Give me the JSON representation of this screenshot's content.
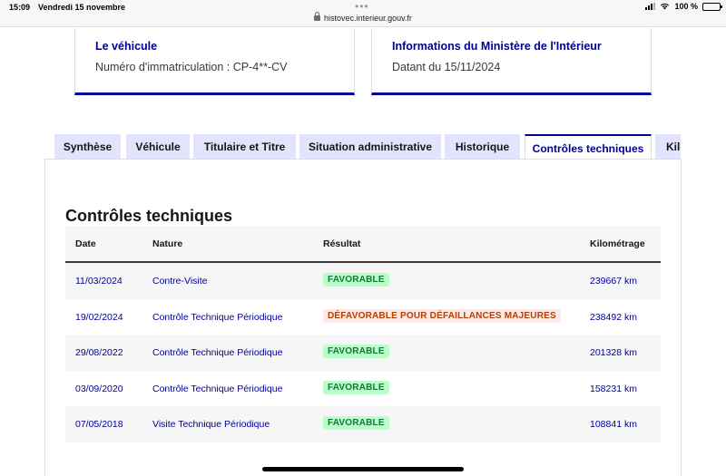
{
  "status_bar": {
    "time": "15:09",
    "date": "Vendredi 15 novembre",
    "url": "histovec.interieur.gouv.fr",
    "battery": "100 %"
  },
  "cards": {
    "vehicle": {
      "title": "Le véhicule",
      "text": "Numéro d'immatriculation : CP-4**-CV"
    },
    "ministry": {
      "title": "Informations du Ministère de l'Intérieur",
      "text": "Datant du 15/11/2024"
    }
  },
  "tabs": [
    {
      "label": "Synthèse"
    },
    {
      "label": "Véhicule"
    },
    {
      "label": "Titulaire et Titre"
    },
    {
      "label": "Situation administrative"
    },
    {
      "label": "Historique"
    },
    {
      "label": "Contrôles techniques"
    },
    {
      "label": "Kilométrage"
    }
  ],
  "section": {
    "title": "Contrôles techniques"
  },
  "table": {
    "headers": {
      "date": "Date",
      "nature": "Nature",
      "result": "Résultat",
      "km": "Kilométrage"
    },
    "rows": [
      {
        "date": "11/03/2024",
        "nature": "Contre-Visite",
        "result": "FAVORABLE",
        "km": "239667 km"
      },
      {
        "date": "19/02/2024",
        "nature": "Contrôle Technique Périodique",
        "result": "DÉFAVORABLE POUR DÉFAILLANCES MAJEURES",
        "km": "238492 km"
      },
      {
        "date": "29/08/2022",
        "nature": "Contrôle Technique Périodique",
        "result": "FAVORABLE",
        "km": "201328 km"
      },
      {
        "date": "03/09/2020",
        "nature": "Contrôle Technique Périodique",
        "result": "FAVORABLE",
        "km": "158231 km"
      },
      {
        "date": "07/05/2018",
        "nature": "Visite Technique Périodique",
        "result": "FAVORABLE",
        "km": "108841 km"
      }
    ]
  },
  "colors": {
    "primary": "#000091",
    "tab_bg": "#e3e3fd",
    "success_bg": "#b8fec9",
    "success_text": "#18753c",
    "error_bg": "#ffe9e6",
    "error_text": "#b34000"
  },
  "icons": [
    "lock-icon",
    "signal-icon",
    "wifi-icon",
    "battery-icon"
  ]
}
